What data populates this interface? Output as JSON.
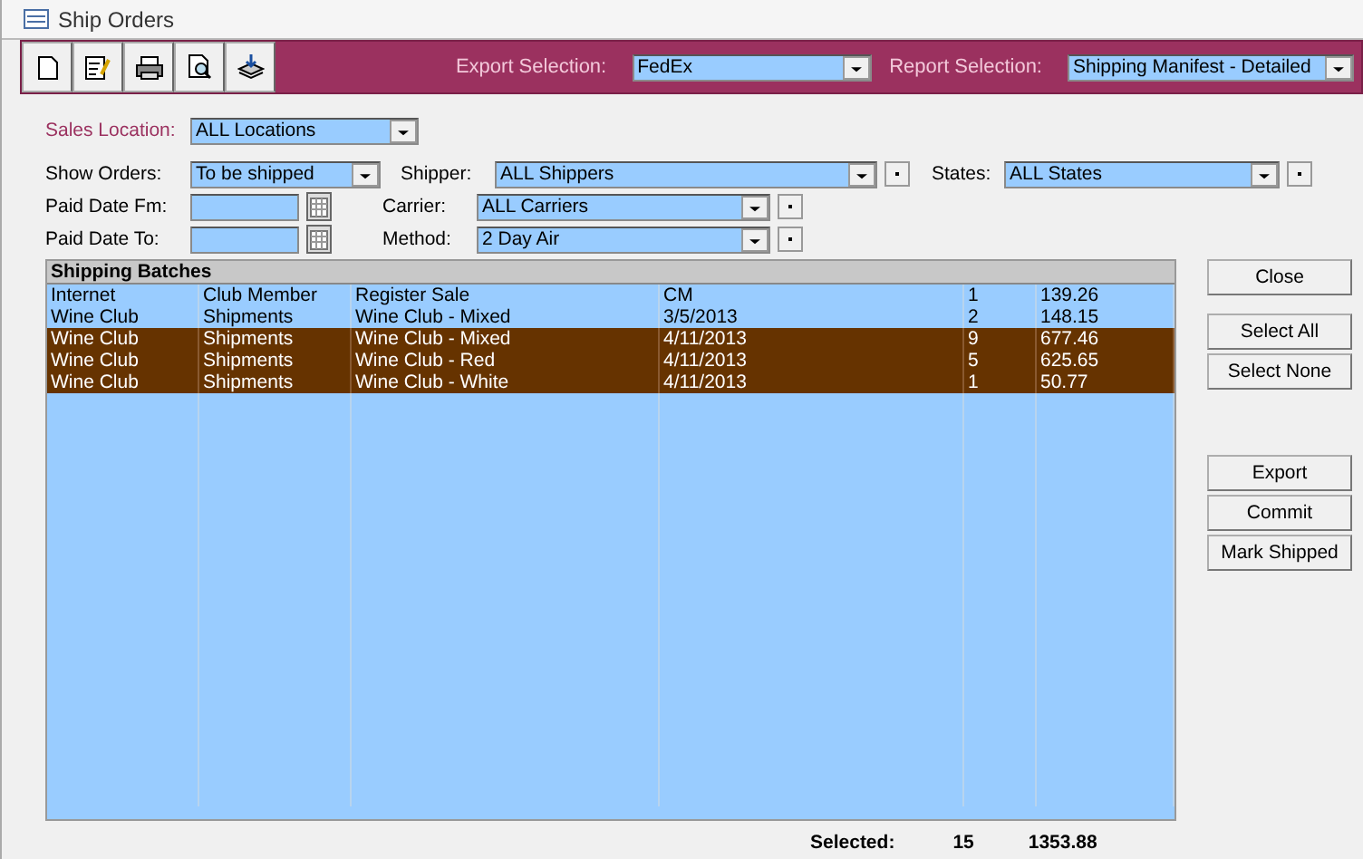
{
  "window": {
    "title": "Ship Orders"
  },
  "toolbar": {
    "tools": [
      {
        "kind": "new"
      },
      {
        "kind": "edit"
      },
      {
        "kind": "print"
      },
      {
        "kind": "preview"
      },
      {
        "kind": "export"
      }
    ],
    "export_selection": {
      "label": "Export Selection:",
      "value": "FedEx"
    },
    "report_selection": {
      "label": "Report Selection:",
      "value": "Shipping Manifest - Detailed"
    }
  },
  "filters": {
    "sales_location": {
      "label": "Sales Location:",
      "value": "ALL Locations"
    },
    "show_orders": {
      "label": "Show Orders:",
      "value": "To be shipped"
    },
    "paid_date_from": {
      "label": "Paid Date Fm:"
    },
    "paid_date_to": {
      "label": "Paid Date To:"
    },
    "shipper": {
      "label": "Shipper:",
      "value": "ALL Shippers"
    },
    "carrier": {
      "label": "Carrier:",
      "value": "ALL Carriers"
    },
    "method": {
      "label": "Method:",
      "value": "2 Day Air"
    },
    "states": {
      "label": "States:",
      "value": "ALL States"
    }
  },
  "table": {
    "title": "Shipping Batches",
    "rows": [
      {
        "cells": [
          "Internet",
          "Club Member",
          "Register Sale",
          "CM",
          "1",
          "139.26"
        ],
        "selected": false
      },
      {
        "cells": [
          "Wine Club",
          "Shipments",
          "Wine Club - Mixed",
          "3/5/2013",
          "2",
          "148.15"
        ],
        "selected": false
      },
      {
        "cells": [
          "Wine Club",
          "Shipments",
          "Wine Club - Mixed",
          "4/11/2013",
          "9",
          "677.46"
        ],
        "selected": true
      },
      {
        "cells": [
          "Wine Club",
          "Shipments",
          "Wine Club - Red",
          "4/11/2013",
          "5",
          "625.65"
        ],
        "selected": true
      },
      {
        "cells": [
          "Wine Club",
          "Shipments",
          "Wine Club - White",
          "4/11/2013",
          "1",
          "50.77"
        ],
        "selected": true
      }
    ]
  },
  "buttons": [
    {
      "label": "Close"
    },
    {
      "label": "Select All"
    },
    {
      "label": "Select None"
    },
    {
      "label": "Export"
    },
    {
      "label": "Commit"
    },
    {
      "label": "Mark Shipped"
    }
  ],
  "totals": {
    "label": "Selected:",
    "count": "15",
    "amount": "1353.88"
  }
}
